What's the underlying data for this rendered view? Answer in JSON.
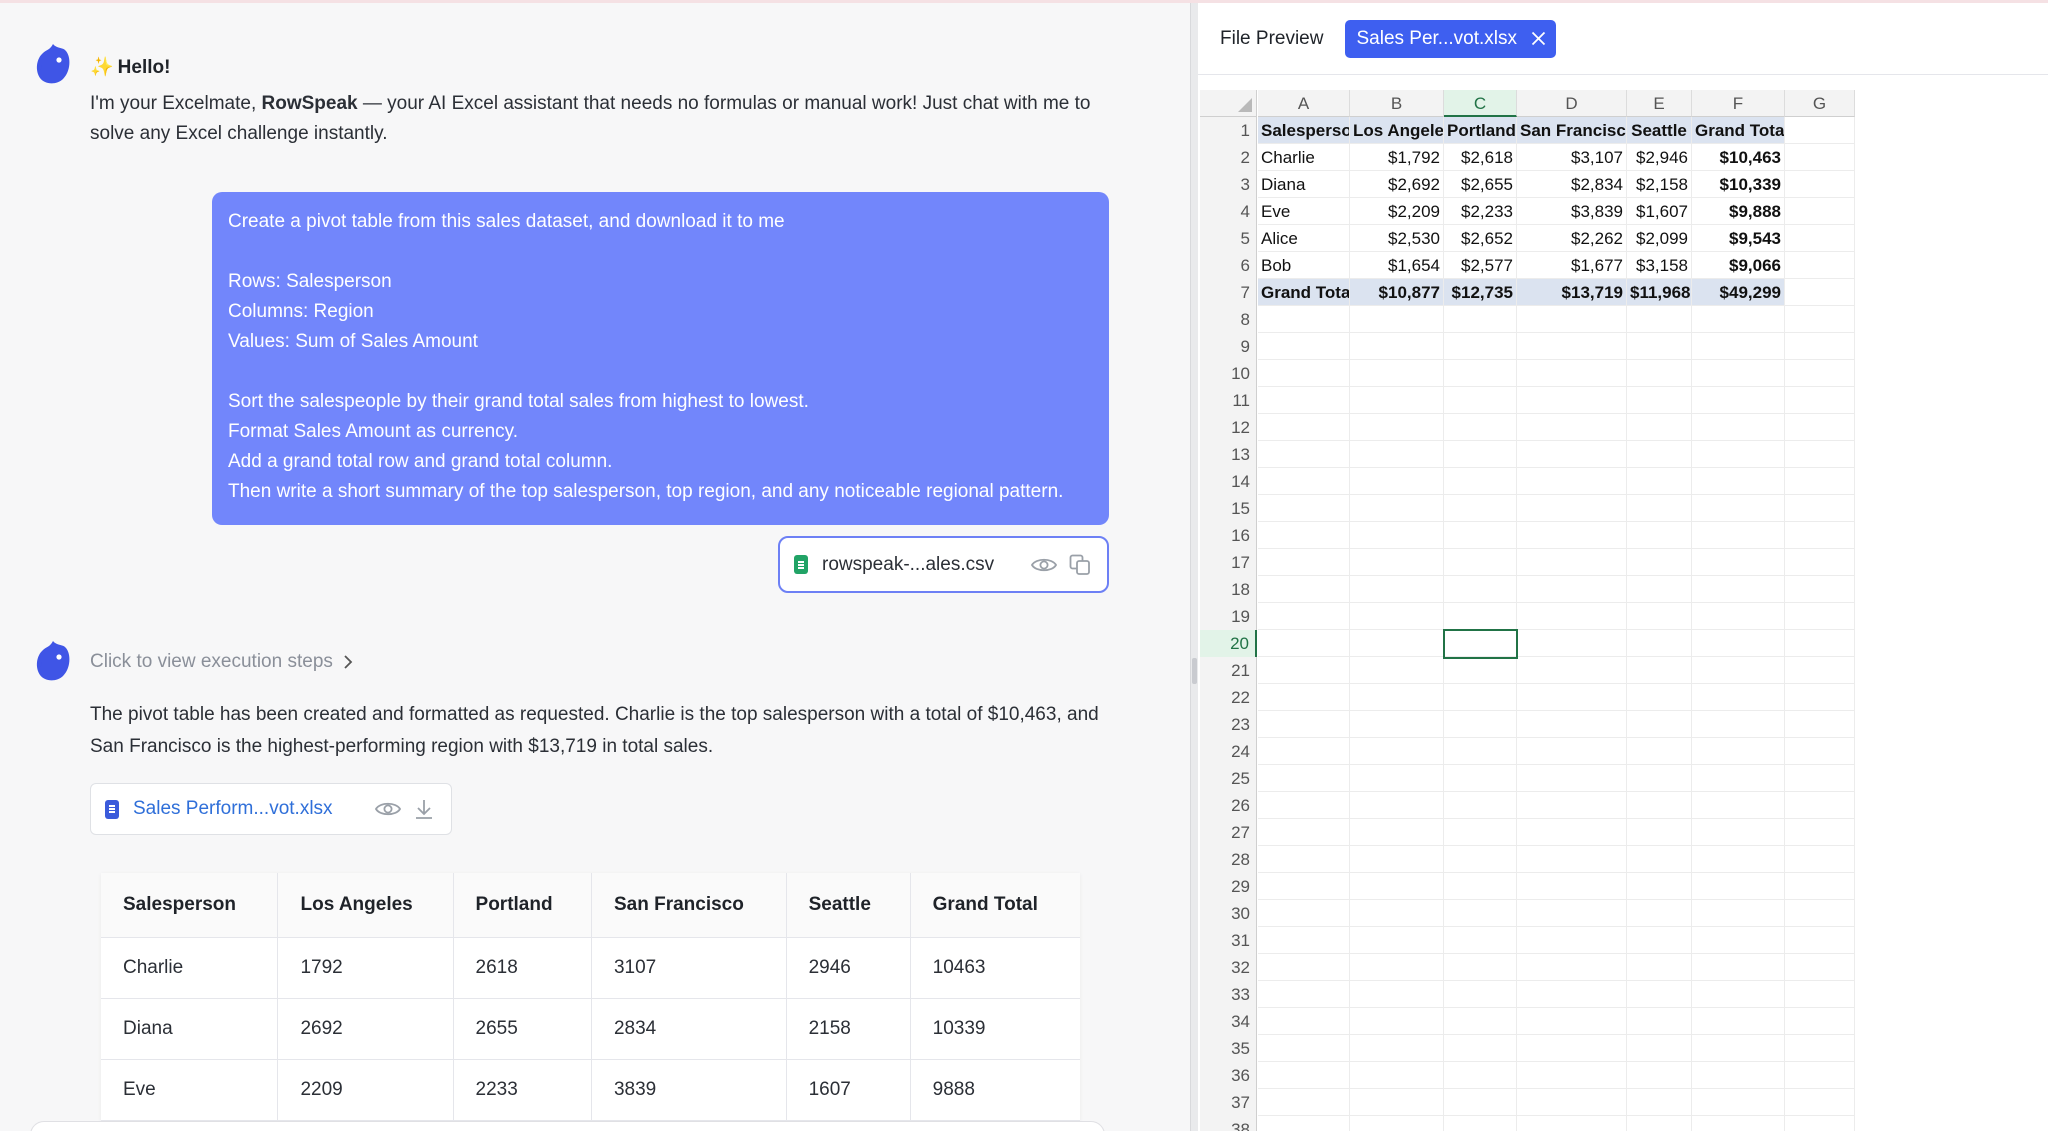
{
  "greeting": {
    "title": "Hello!",
    "spark": "✨",
    "body_pre": "I'm your Excelmate, ",
    "body_brand": "RowSpeak",
    "body_post": " — your AI Excel assistant that needs no formulas or manual work! Just chat with me to solve any Excel challenge instantly."
  },
  "user_message": {
    "lines": [
      "Create a pivot table from this sales dataset, and download it to me",
      "",
      "Rows: Salesperson",
      "Columns: Region",
      "Values: Sum of Sales Amount",
      "",
      "Sort the salespeople by their grand total sales from highest to lowest.",
      "Format Sales Amount as currency.",
      "Add a grand total row and grand total column.",
      "Then write a short summary of the top salesperson, top region, and any noticeable regional pattern."
    ],
    "attachment": "rowspeak-...ales.csv"
  },
  "assistant": {
    "steps_label": "Click to view execution steps",
    "reply": "The pivot table has been created and formatted as requested. Charlie is the top salesperson with a total of $10,463, and San Francisco is the highest-performing region with $13,719 in total sales.",
    "output_file": "Sales Perform...vot.xlsx"
  },
  "result_table": {
    "headers": [
      "Salesperson",
      "Los Angeles",
      "Portland",
      "San Francisco",
      "Seattle",
      "Grand Total"
    ],
    "rows": [
      [
        "Charlie",
        "1792",
        "2618",
        "3107",
        "2946",
        "10463"
      ],
      [
        "Diana",
        "2692",
        "2655",
        "2834",
        "2158",
        "10339"
      ],
      [
        "Eve",
        "2209",
        "2233",
        "3839",
        "1607",
        "9888"
      ]
    ]
  },
  "preview": {
    "title": "File Preview",
    "tab": "Sales Per...vot.xlsx",
    "columns": [
      "A",
      "B",
      "C",
      "D",
      "E",
      "F",
      "G"
    ],
    "selected_column": "C",
    "selected_row": 20,
    "row_count": 38,
    "grid": [
      [
        "Salesperson",
        "Los Angeles",
        "Portland",
        "San Francisco",
        "Seattle",
        "Grand Total"
      ],
      [
        "Charlie",
        "$1,792",
        "$2,618",
        "$3,107",
        "$2,946",
        "$10,463"
      ],
      [
        "Diana",
        "$2,692",
        "$2,655",
        "$2,834",
        "$2,158",
        "$10,339"
      ],
      [
        "Eve",
        "$2,209",
        "$2,233",
        "$3,839",
        "$1,607",
        "$9,888"
      ],
      [
        "Alice",
        "$2,530",
        "$2,652",
        "$2,262",
        "$2,099",
        "$9,543"
      ],
      [
        "Bob",
        "$1,654",
        "$2,577",
        "$1,677",
        "$3,158",
        "$9,066"
      ],
      [
        "Grand Total",
        "$10,877",
        "$12,735",
        "$13,719",
        "$11,968",
        "$49,299"
      ]
    ]
  },
  "colors": {
    "user_bubble": "#7286fb",
    "tab_accent": "#3e5ff0",
    "excel_green": "#217346",
    "header_fill": "#dbe3f0"
  }
}
